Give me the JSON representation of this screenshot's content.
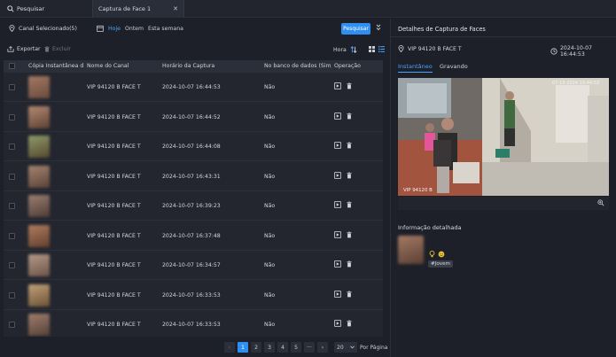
{
  "tabs": [
    {
      "label": "Pesquisar"
    },
    {
      "label": "Captura de Face 1"
    }
  ],
  "filter": {
    "channel_label": "Canal Selecionado(5)",
    "date_today": "Hoje",
    "date_yesterday": "Ontem",
    "date_week": "Esta semana",
    "search_button": "Pesquisar"
  },
  "toolbar": {
    "export_label": "Exportar",
    "delete_label": "Excluir",
    "sort_label": "Hora"
  },
  "table": {
    "columns": [
      "Cópia Instantânea d...",
      "Nome do Canal",
      "Horário da Captura",
      "No banco de dados (Sim/...",
      "Operação"
    ],
    "rows": [
      {
        "channel": "VIP 94120 B FACE T",
        "time": "2024-10-07 16:44:53",
        "in_db": "Não"
      },
      {
        "channel": "VIP 94120 B FACE T",
        "time": "2024-10-07 16:44:52",
        "in_db": "Não"
      },
      {
        "channel": "VIP 94120 B FACE T",
        "time": "2024-10-07 16:44:08",
        "in_db": "Não"
      },
      {
        "channel": "VIP 94120 B FACE T",
        "time": "2024-10-07 16:43:31",
        "in_db": "Não"
      },
      {
        "channel": "VIP 94120 B FACE T",
        "time": "2024-10-07 16:39:23",
        "in_db": "Não"
      },
      {
        "channel": "VIP 94120 B FACE T",
        "time": "2024-10-07 16:37:48",
        "in_db": "Não"
      },
      {
        "channel": "VIP 94120 B FACE T",
        "time": "2024-10-07 16:34:57",
        "in_db": "Não"
      },
      {
        "channel": "VIP 94120 B FACE T",
        "time": "2024-10-07 16:33:53",
        "in_db": "Não"
      },
      {
        "channel": "VIP 94120 B FACE T",
        "time": "2024-10-07 16:33:53",
        "in_db": "Não"
      }
    ]
  },
  "pager": {
    "prev": "‹",
    "pages": [
      "1",
      "2",
      "3",
      "4",
      "5"
    ],
    "ellipsis": "···",
    "next": "›",
    "page_size": "20",
    "page_size_label": "Por Página",
    "active_page": "1"
  },
  "details": {
    "title": "Detalhes de Captura de Faces",
    "channel": "VIP 94120 B FACE T",
    "timestamp": "2024-10-07 16:44:53",
    "tab_snapshot": "Instantâneo",
    "tab_recording": "Gravando",
    "video_osd_time": "07-10-2024 16:44:53",
    "video_osd_channel": "VIP 94120 B",
    "info_title": "Informação detalhada",
    "tag_label": "#Jovem"
  },
  "icons": {
    "search": "search-icon",
    "close": "close-icon",
    "location": "location-pin-icon",
    "calendar": "calendar-icon",
    "export": "export-icon",
    "delete": "trash-icon",
    "sort": "sort-icon",
    "grid": "grid-view-icon",
    "list": "list-view-icon",
    "play": "playback-icon",
    "clock": "clock-icon",
    "zoom": "zoom-in-icon",
    "expand": "chevron-double-down-icon"
  },
  "colors": {
    "accent": "#2f8ff0",
    "background": "#1b1e26",
    "panel": "#23262f"
  }
}
